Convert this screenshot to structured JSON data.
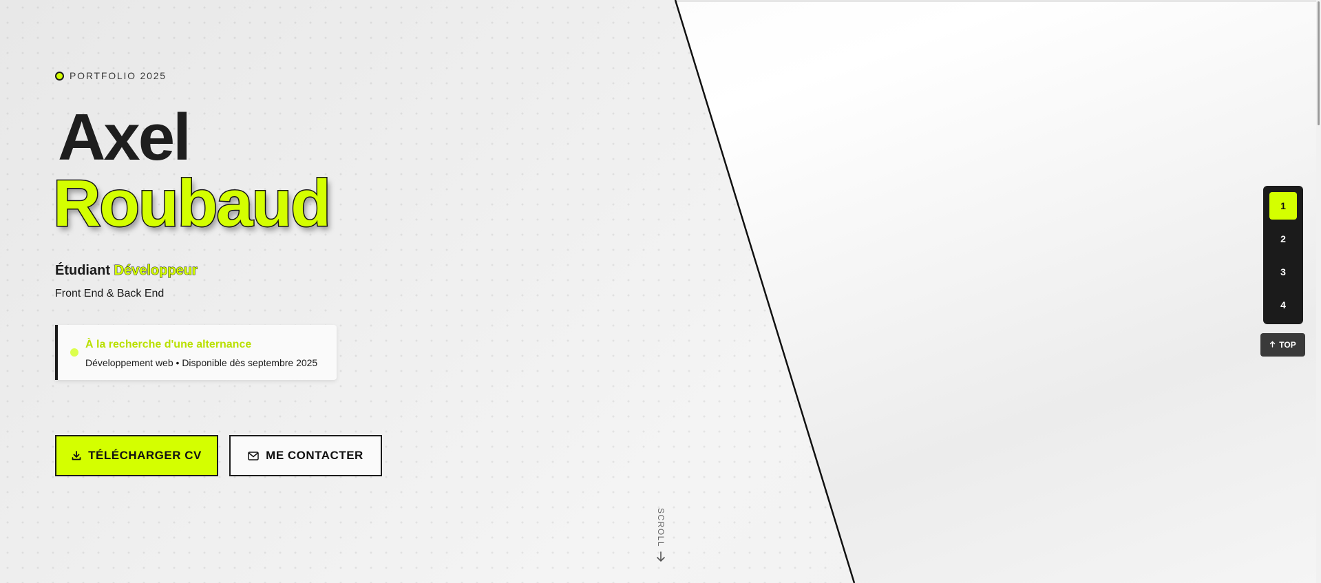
{
  "hero": {
    "eyebrow": "PORTFOLIO 2025",
    "first_name": "Axel",
    "last_name": "Roubaud",
    "role_prefix": "Étudiant",
    "role_accent": "Développeur",
    "stack": "Front End & Back End"
  },
  "status": {
    "title": "À la recherche d'une alternance",
    "subtitle": "Développement web • Disponible dès septembre 2025"
  },
  "buttons": {
    "download_cv": "TÉLÉCHARGER CV",
    "contact": "ME CONTACTER"
  },
  "scroll": {
    "label": "SCROLL"
  },
  "side_nav": {
    "items": [
      "1",
      "2",
      "3",
      "4"
    ],
    "active": "1",
    "top_label": "TOP"
  },
  "colors": {
    "accent": "#d4ff00",
    "dark": "#1b1b1b",
    "status_title": "#b9e000"
  },
  "icons": {
    "download": "download-icon",
    "contact": "mail-icon",
    "scroll": "arrow-down-icon",
    "top": "arrow-up-icon"
  }
}
